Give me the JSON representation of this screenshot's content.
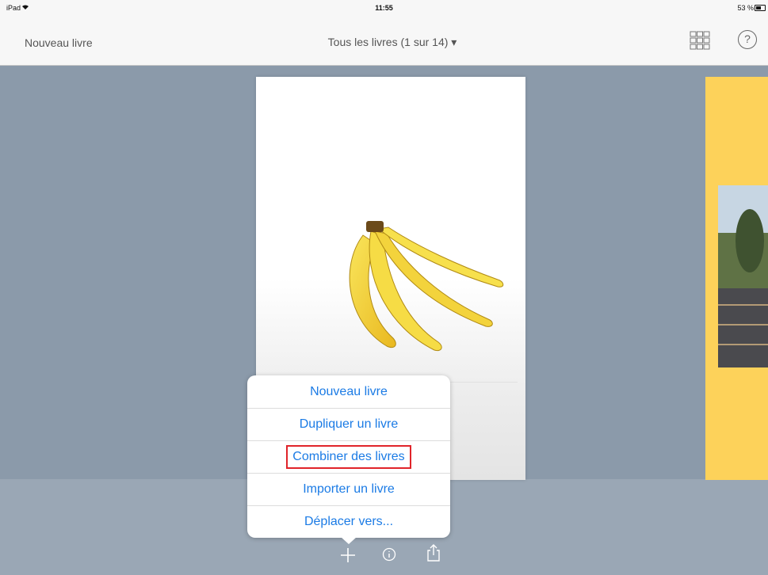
{
  "status_bar": {
    "carrier": "iPad",
    "time": "11:55",
    "battery": "53 %"
  },
  "nav_bar": {
    "new_book": "Nouveau livre",
    "title": "Tous les livres (1 sur 14) ▾"
  },
  "popover": {
    "items": [
      {
        "label": "Nouveau livre"
      },
      {
        "label": "Dupliquer un livre"
      },
      {
        "label": "Combiner des livres",
        "highlighted": true,
        "highlight_color": "#e0242a"
      },
      {
        "label": "Importer un livre"
      },
      {
        "label": "Déplacer vers..."
      }
    ]
  },
  "toolbar": {
    "icons": [
      "plus-icon",
      "info-icon",
      "share-icon"
    ]
  },
  "icons": {
    "help": "?",
    "grid": "grid-icon",
    "wifi": "wifi-icon"
  },
  "colors": {
    "accent": "#1b7be5",
    "canvas": "#8b9aaa",
    "highlight": "#e0242a",
    "second_book": "#fdd25a"
  }
}
